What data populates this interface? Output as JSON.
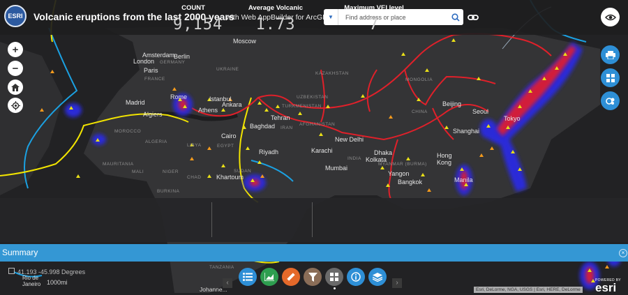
{
  "header": {
    "logo_text": "ESRI",
    "title": "Volcanic eruptions from the last 2000 years",
    "subtitle": "with Web AppBuilder for ArcGIS",
    "search_placeholder": "Find address or place",
    "icons": {
      "source": "caret-down-icon",
      "search": "search-icon",
      "link": "link-icon",
      "eye": "eye-icon"
    }
  },
  "map_controls": {
    "zoom_in": "+",
    "zoom_out": "−",
    "home_icon": "home-icon",
    "locate_icon": "locate-icon"
  },
  "side_widgets": [
    "print-icon",
    "basemap-gallery-icon",
    "layer-settings-icon"
  ],
  "map_labels": {
    "cities": [
      "Moscow",
      "Amsterdam",
      "Berlin",
      "London",
      "Paris",
      "Rome",
      "Madrid",
      "Algiers",
      "Istanbul",
      "Athens",
      "Ankara",
      "Tehran",
      "Baghdad",
      "Cairo",
      "Riyadh",
      "Karachi",
      "New Delhi",
      "Mumbai",
      "Dhaka",
      "Kolkata",
      "Yangon",
      "Bangkok",
      "Beijing",
      "Seoul",
      "Shanghai",
      "Tokyo",
      "Hong Kong",
      "Manila",
      "Khartoum",
      "Rio de Janeiro",
      "Johannesburg"
    ],
    "countries": [
      "GERMANY",
      "FRANCE",
      "UKRAINE",
      "KAZAKHSTAN",
      "UZBEKISTAN",
      "TURKMENISTAN",
      "MONGOLIA",
      "CHINA",
      "IRAN",
      "AFGHANISTAN",
      "INDIA",
      "MYANMAR (BURMA)",
      "MOROCCO",
      "ALGERIA",
      "LIBYA",
      "EGYPT",
      "MAURITANIA",
      "MALI",
      "NIGER",
      "CHAD",
      "SUDAN"
    ]
  },
  "stats": [
    {
      "caption": "COUNT",
      "value": "9,154"
    },
    {
      "caption": "Average Volcanic",
      "value": "1.73"
    },
    {
      "caption": "Maximum VEI level",
      "value": "7"
    }
  ],
  "summary": {
    "title": "Summary",
    "close": "×"
  },
  "coordinates": {
    "text": "41.193  -45.998 Degrees"
  },
  "scale": {
    "label": "1000mi"
  },
  "toolbar": [
    "legend-icon",
    "chart-icon",
    "measure-icon",
    "filter-icon",
    "widget-grid-icon",
    "about-icon",
    "layer-list-icon"
  ],
  "toolbar_colors": [
    "#2e8fd6",
    "#2e9e4f",
    "#e5692a",
    "#8a6d57",
    "#6a6a6a",
    "#2e8fd6",
    "#2e8fd6"
  ],
  "attribution": "Esri, DeLorme, NGA, USGS | Esri, HERE, DeLorme",
  "esri_logo": {
    "powered": "POWERED BY",
    "name": "esri"
  }
}
